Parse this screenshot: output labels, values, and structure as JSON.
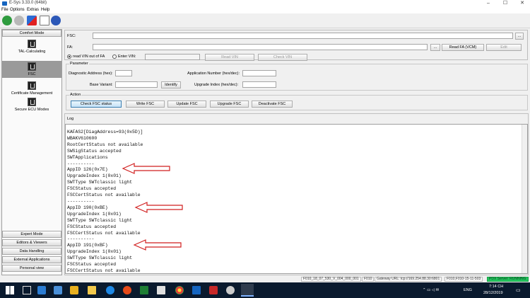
{
  "window": {
    "title": "E-Sys 3.33.0  (64bit)",
    "controls": [
      "–",
      "☐",
      "✕"
    ]
  },
  "menu": [
    "File",
    "Options",
    "Extras",
    "Help"
  ],
  "sidebar": {
    "header": "Comfort Mode",
    "items": [
      {
        "label": "TAL-Calculating"
      },
      {
        "label": "FSC",
        "selected": true
      },
      {
        "label": "Certificate Management"
      },
      {
        "label": "Secure ECU Modes"
      }
    ],
    "bottom": [
      "Expert Mode",
      "Editors & Viewers",
      "Data Handling",
      "External Applications",
      "Personal view"
    ]
  },
  "fsc_panel": {
    "fsc_label": "FSC:",
    "fsc_browse": "...",
    "fa_label": "FA:",
    "fa_browse": "...",
    "read_fa_button": "Read FA (VCM)",
    "edit_button": "Edit",
    "radio_read_vin": "read VIN out of FA",
    "radio_enter_vin": "Enter VIN:",
    "read_vin_button": "Read VIN",
    "check_vin_button": "Check VIN"
  },
  "parameter": {
    "title": "Parameter",
    "diag_label": "Diagnostic Address (hex):",
    "app_label": "Application Number (hex/dec):",
    "base_label": "Base Variant:",
    "identify_button": "Identify",
    "upgrade_label": "Upgrade Index (hex/dec):"
  },
  "action": {
    "title": "Action",
    "buttons": [
      "Check FSC status",
      "Write FSC",
      "Update FSC",
      "Upgrade FSC",
      "Deactivate FSC"
    ]
  },
  "log": {
    "title": "Log",
    "lines": [
      "KAFAS2[DiagAddress=93(0x5D)]",
      "WBAKV610600",
      "RootCertStatus not available",
      "SWSigStatus accepted",
      "SWTApplications",
      "----------",
      "AppID 126(0x7E)",
      "UpgradeIndex 1(0x01)",
      "SWTType SWTclassic light",
      "FSCStatus accepted",
      "FSCCertStatus not available",
      "----------",
      "AppID 190(0xBE)",
      "UpgradeIndex 1(0x01)",
      "SWTType SWTclassic light",
      "FSCStatus accepted",
      "FSCCertStatus not available",
      "----------",
      "AppID 191(0xBF)",
      "UpgradeIndex 1(0x01)",
      "SWTType SWTclassic light",
      "FSCStatus accepted",
      "FSCCertStatus not available"
    ]
  },
  "status_bar": {
    "project": "F010_18_07_530_V_004_000_001",
    "series": "F010",
    "gateway": "Gateway URL: tcp://169.254.88.30:6801",
    "vehicle": "F010,F010-15-11-503",
    "server": "PDX Server: RUNNING",
    "server_color": "#22c55e"
  },
  "taskbar": {
    "time": "7:14 CH",
    "date": "28/12/2019",
    "lang": "ENG"
  },
  "colors": {
    "annotation_arrow": "#d11f1f",
    "taskbar": "#0a1a2e"
  }
}
